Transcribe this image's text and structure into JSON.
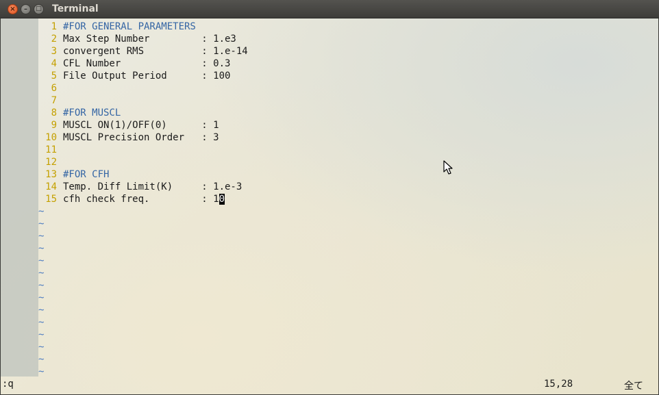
{
  "window": {
    "title": "Terminal",
    "close_glyph": "×",
    "min_glyph": "–",
    "max_glyph": "□"
  },
  "editor": {
    "lines": [
      {
        "num": "1",
        "text": "#FOR GENERAL PARAMETERS",
        "type": "comment"
      },
      {
        "num": "2",
        "text": "Max Step Number         : 1.e3",
        "type": "code"
      },
      {
        "num": "3",
        "text": "convergent RMS          : 1.e-14",
        "type": "code"
      },
      {
        "num": "4",
        "text": "CFL Number              : 0.3",
        "type": "code"
      },
      {
        "num": "5",
        "text": "File Output Period      : 100",
        "type": "code"
      },
      {
        "num": "6",
        "text": "",
        "type": "code"
      },
      {
        "num": "7",
        "text": "",
        "type": "code"
      },
      {
        "num": "8",
        "text": "#FOR MUSCL",
        "type": "comment"
      },
      {
        "num": "9",
        "text": "MUSCL ON(1)/OFF(0)      : 1",
        "type": "code"
      },
      {
        "num": "10",
        "text": "MUSCL Precision Order   : 3",
        "type": "code"
      },
      {
        "num": "11",
        "text": "",
        "type": "code"
      },
      {
        "num": "12",
        "text": "",
        "type": "code"
      },
      {
        "num": "13",
        "text": "#FOR CFH",
        "type": "comment"
      },
      {
        "num": "14",
        "text": "Temp. Diff Limit(K)     : 1.e-3",
        "type": "code"
      },
      {
        "num": "15",
        "text_before": "cfh check freq.         : 1",
        "cursor_char": "0",
        "type": "cursor"
      }
    ],
    "tilde": "~",
    "tilde_count": 14
  },
  "status": {
    "command": ":q",
    "position": "15,28",
    "scroll": "全て"
  },
  "icons": {
    "close": "close-icon",
    "minimize": "minimize-icon",
    "maximize": "maximize-icon",
    "pointer": "mouse-pointer-icon"
  },
  "colors": {
    "line_number": "#c4a000",
    "comment": "#3465a4",
    "tilde": "#4b7bc0"
  }
}
